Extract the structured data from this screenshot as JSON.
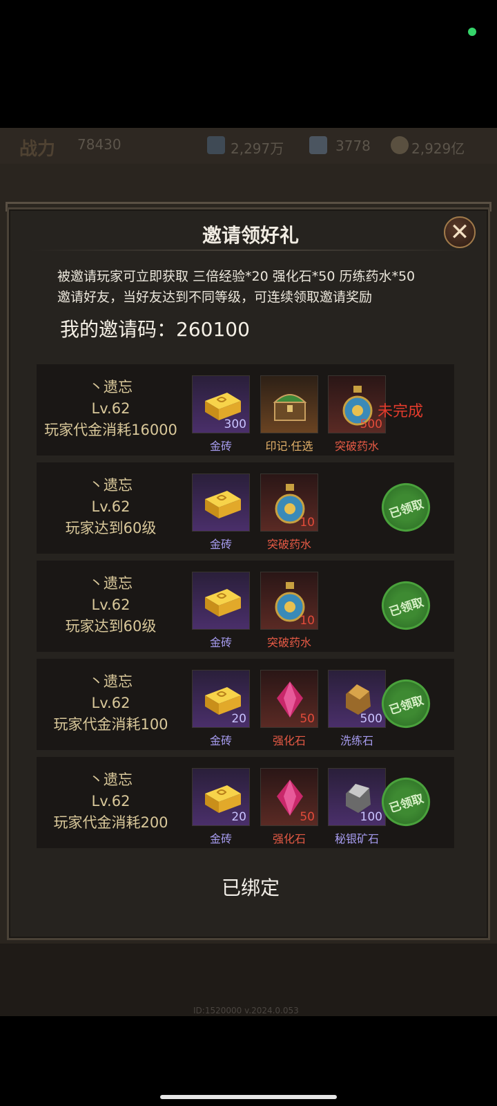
{
  "background": {
    "combat_power_label": "战力",
    "combat_power_value": "78430",
    "currency_1": "2,297万",
    "currency_2": "3778",
    "currency_3": "2,929亿",
    "footer_text": "ID:1520000 v.2024.0.053"
  },
  "modal": {
    "title": "邀请领好礼",
    "close_symbol": "✕",
    "desc_line1": "被邀请玩家可立即获取 三倍经验*20  强化石*50   历练药水*50",
    "desc_line2": "邀请好友，当好友达到不同等级，可连续领取邀请奖励",
    "invite_code_label": "我的邀请码：",
    "invite_code": "260100",
    "bound_status": "已绑定"
  },
  "rows": [
    {
      "player": "丶遗忘",
      "level": "Lv.62",
      "condition": "玩家代金消耗16000",
      "status": "未完成",
      "items": [
        {
          "name": "金砖",
          "count": "300",
          "rarity": "purple",
          "icon": "gold-bar-icon"
        },
        {
          "name": "印记·任选",
          "count": "",
          "rarity": "orange",
          "icon": "treasure-chest-icon"
        },
        {
          "name": "突破药水",
          "count": "500",
          "rarity": "red",
          "icon": "potion-icon"
        }
      ]
    },
    {
      "player": "丶遗忘",
      "level": "Lv.62",
      "condition": "玩家达到60级",
      "status": "已领取",
      "items": [
        {
          "name": "金砖",
          "count": "",
          "rarity": "purple",
          "icon": "gold-bar-icon"
        },
        {
          "name": "突破药水",
          "count": "10",
          "rarity": "red",
          "icon": "potion-icon"
        }
      ]
    },
    {
      "player": "丶遗忘",
      "level": "Lv.62",
      "condition": "玩家达到60级",
      "status": "已领取",
      "items": [
        {
          "name": "金砖",
          "count": "",
          "rarity": "purple",
          "icon": "gold-bar-icon"
        },
        {
          "name": "突破药水",
          "count": "10",
          "rarity": "red",
          "icon": "potion-icon"
        }
      ]
    },
    {
      "player": "丶遗忘",
      "level": "Lv.62",
      "condition": "玩家代金消耗100",
      "status": "已领取",
      "items": [
        {
          "name": "金砖",
          "count": "20",
          "rarity": "purple",
          "icon": "gold-bar-icon"
        },
        {
          "name": "强化石",
          "count": "50",
          "rarity": "red",
          "icon": "gem-icon"
        },
        {
          "name": "洗练石",
          "count": "500",
          "rarity": "purple",
          "icon": "ore-icon"
        }
      ]
    },
    {
      "player": "丶遗忘",
      "level": "Lv.62",
      "condition": "玩家代金消耗200",
      "status": "已领取",
      "items": [
        {
          "name": "金砖",
          "count": "20",
          "rarity": "purple",
          "icon": "gold-bar-icon"
        },
        {
          "name": "强化石",
          "count": "50",
          "rarity": "red",
          "icon": "gem-icon"
        },
        {
          "name": "秘银矿石",
          "count": "100",
          "rarity": "purple",
          "icon": "silver-ore-icon"
        }
      ]
    }
  ],
  "colors": {
    "incomplete": "#e23b2c",
    "claimed_stamp": "#3e8a32",
    "item_name_purple": "#a79cf0",
    "item_name_red": "#e65a45",
    "item_name_orange": "#e6b36a",
    "row_info": "#d9c89a"
  }
}
